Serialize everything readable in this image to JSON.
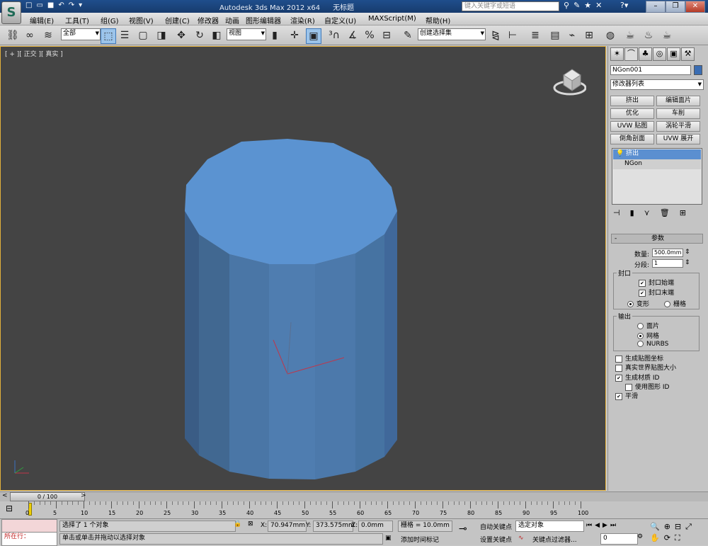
{
  "title_bar": {
    "app_title": "Autodesk 3ds Max  2012 x64",
    "doc_title": "无标题",
    "search_placeholder": "键入关键字或短语",
    "quick_access_icons": [
      "new-file-icon",
      "open-file-icon",
      "save-icon",
      "undo-icon",
      "redo-icon",
      "dropdown-icon"
    ]
  },
  "menu": {
    "items": [
      "编辑(E)",
      "工具(T)",
      "组(G)",
      "视图(V)",
      "创建(C)",
      "修改器",
      "动画",
      "图形编辑器",
      "渲染(R)",
      "自定义(U)",
      "MAXScript(M)",
      "帮助(H)"
    ]
  },
  "toolbar": {
    "selection_filter": "全部",
    "ref_coord": "视图",
    "named_selection": "创建选择集"
  },
  "viewport": {
    "label": "[ + ][ 正交 ][ 真实 ]",
    "object_color": "#5b93d1",
    "border_color": "#e2b13c",
    "background": "#444444"
  },
  "command_panel": {
    "object_name": "NGon001",
    "object_color": "#3a6db3",
    "modifier_list": "修改器列表",
    "modifier_buttons": [
      "挤出",
      "编辑面片",
      "优化",
      "车削",
      "UVW 贴图",
      "涡轮平滑",
      "倒角剖面",
      "UVW 展开"
    ],
    "stack": [
      "挤出",
      "NGon"
    ],
    "params": {
      "header": "参数",
      "amount_label": "数量:",
      "amount_value": "500.0mm",
      "segments_label": "分段:",
      "segments_value": "1",
      "cap_group": "封口",
      "cap_start": "封口始端",
      "cap_end": "封口末端",
      "morph": "变形",
      "grid": "栅格",
      "output_group": "输出",
      "patch": "面片",
      "mesh": "网格",
      "nurbs": "NURBS",
      "gen_mapping": "生成贴图坐标",
      "real_world": "真实世界贴图大小",
      "gen_mat_ids": "生成材质 ID",
      "use_shape_ids": "使用图形 ID",
      "smooth": "平滑",
      "checked": {
        "cap_start": true,
        "cap_end": true,
        "gen_mapping": false,
        "real_world": false,
        "gen_mat_ids": true,
        "use_shape_ids": false,
        "smooth": true
      },
      "radio_cap": "变形",
      "radio_output": "网格"
    }
  },
  "timeline": {
    "slider_label": "0 / 100",
    "ticks": [
      "0",
      "5",
      "10",
      "15",
      "20",
      "25",
      "30",
      "35",
      "40",
      "45",
      "50",
      "55",
      "60",
      "65",
      "70",
      "75",
      "80",
      "85",
      "90",
      "95",
      "100"
    ]
  },
  "status": {
    "script_label": "所在行：",
    "selection": "选择了 1 个对象",
    "prompt": "单击或单击并拖动以选择对象",
    "x_label": "X:",
    "x_value": "70.947mm",
    "y_label": "Y:",
    "y_value": "373.575mm",
    "z_label": "Z:",
    "z_value": "0.0mm",
    "grid": "栅格 = 10.0mm",
    "add_time_tag": "添加时间标记",
    "auto_key": "自动关键点",
    "set_key": "设置关键点",
    "selected_object": "选定对象",
    "key_filters": "关键点过滤器...",
    "frame_value": "0"
  }
}
